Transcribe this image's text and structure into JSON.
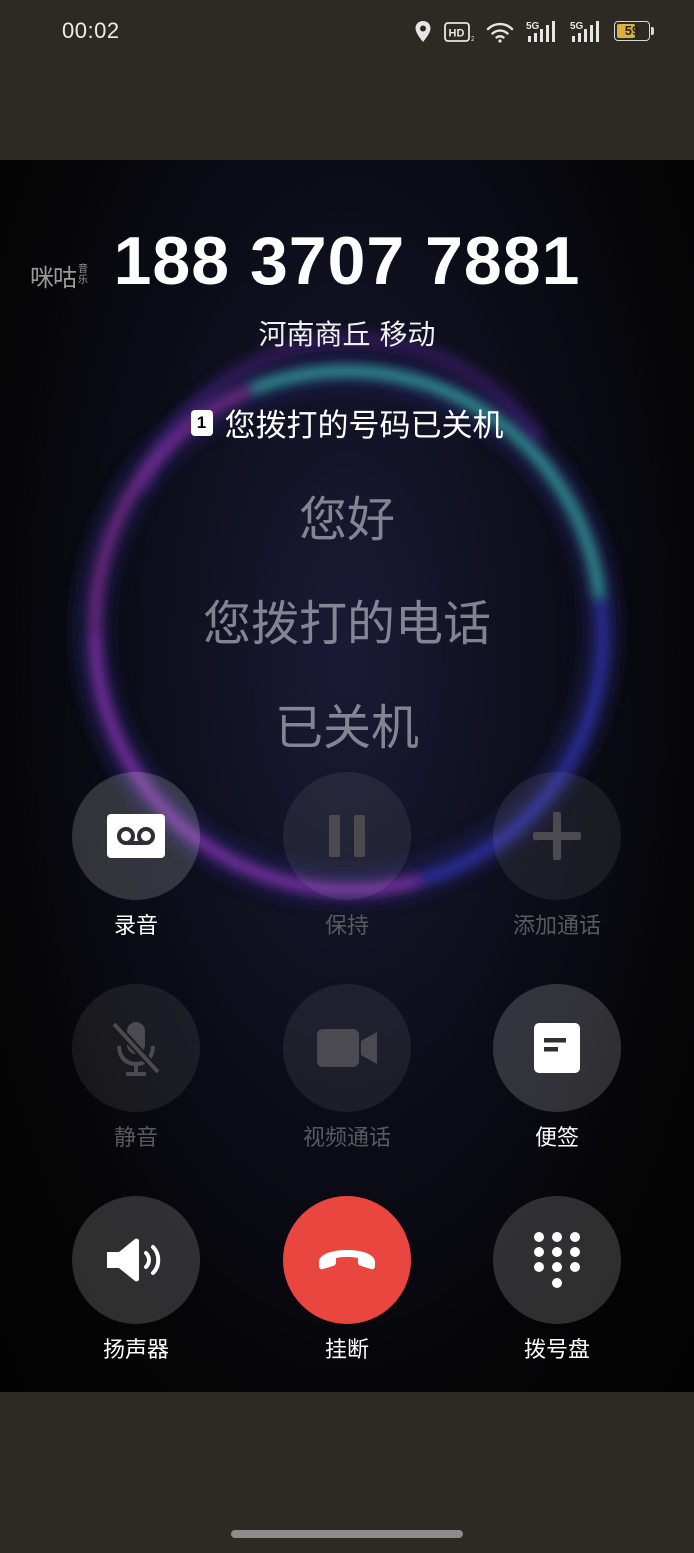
{
  "status_bar": {
    "time": "00:02",
    "hd_badge": "HD",
    "network_1": "5G",
    "network_2": "5G",
    "battery": "59",
    "battery_level": 0.59
  },
  "call": {
    "migu_logo": "咪咕",
    "migu_logo_sub": "音乐",
    "phone_number": "188 3707 7881",
    "location": "河南商丘 移动",
    "sim_slot": "1",
    "caption": "您拨打的号码已关机",
    "transcript": [
      "您好",
      "您拨打的电话",
      "已关机"
    ]
  },
  "controls": {
    "record": "录音",
    "hold": "保持",
    "add_call": "添加通话",
    "mute": "静音",
    "video_call": "视频通话",
    "notes": "便签",
    "speaker": "扬声器",
    "hangup": "挂断",
    "dialpad": "拨号盘"
  },
  "colors": {
    "hangup": "#e9463f",
    "battery_fill": "#d9b13c"
  }
}
